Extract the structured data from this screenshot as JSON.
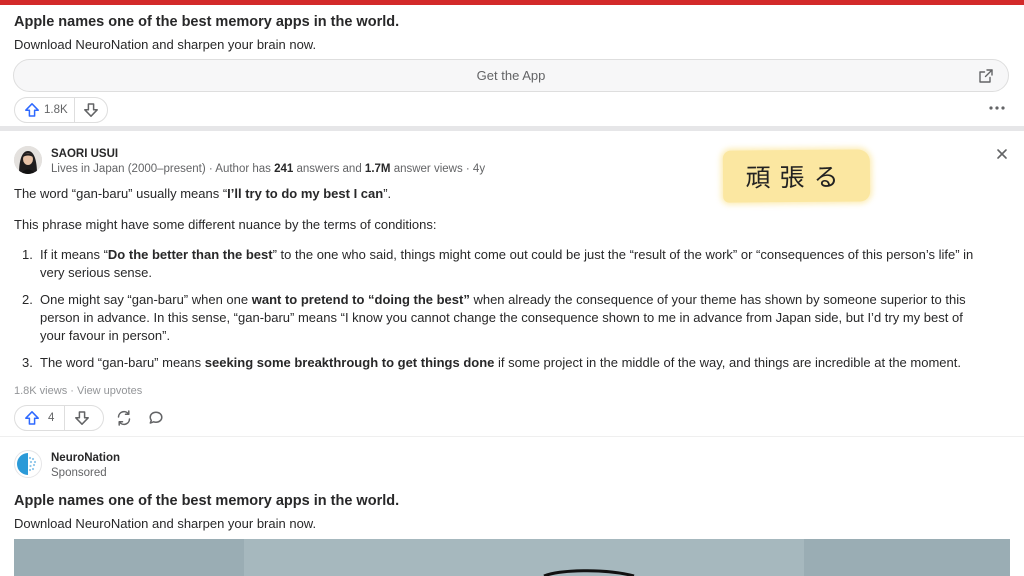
{
  "ad_top": {
    "title": "Apple names one of the best memory apps in the world.",
    "description": "Download NeuroNation and sharpen your brain now.",
    "cta_label": "Get the App",
    "upvotes": "1.8K"
  },
  "answer": {
    "author_name": "SAORI USUI",
    "cred_prefix": "Lives in Japan (2000–present) · Author has ",
    "answers_count": "241",
    "cred_mid": " answers and ",
    "answer_views": "1.7M",
    "cred_suffix": " answer views · 4y",
    "p1_a": "The word “gan-baru” usually means “",
    "p1_b": "I’ll try to do my best I can",
    "p1_c": "”.",
    "p2": "This phrase might have some different nuance by the terms of conditions:",
    "items": [
      {
        "num": "1.",
        "a": "If it means “",
        "b": "Do the better than the best",
        "c": "” to the one who said, things might come out could be just the “result of the work” or “consequences of this person’s life” in very serious sense."
      },
      {
        "num": "2.",
        "a": "One might say “gan-baru” when one ",
        "b": "want to pretend to “doing the best”",
        "c": " when already the consequence of your theme has shown by someone superior to this person in advance. In this sense, “gan-baru” means “I know you cannot change the consequence shown to me in advance from Japan side, but I’d try my best of your favour in person”."
      },
      {
        "num": "3.",
        "a": "The word “gan-baru” means ",
        "b": "seeking some breakthrough to get things done",
        "c": " if some project in the middle of the way, and things are incredible at the moment."
      }
    ],
    "views": "1.8K views",
    "stats_sep": " · ",
    "view_upvotes": "View upvotes",
    "upvotes": "4"
  },
  "overlay_note": "頑張る",
  "ad_bottom": {
    "sponsor_name": "NeuroNation",
    "sponsor_label": "Sponsored",
    "title": "Apple names one of the best memory apps in the world.",
    "description": "Download NeuroNation and sharpen your brain now."
  },
  "colors": {
    "accent_red": "#d32a2a",
    "upvote_blue": "#2e69ff",
    "note_yellow": "#fbe7a1"
  },
  "icons": [
    "upvote-icon",
    "downvote-icon",
    "external-link-icon",
    "more-icon",
    "close-icon",
    "share-icon",
    "comment-icon",
    "brain-logo-icon"
  ]
}
